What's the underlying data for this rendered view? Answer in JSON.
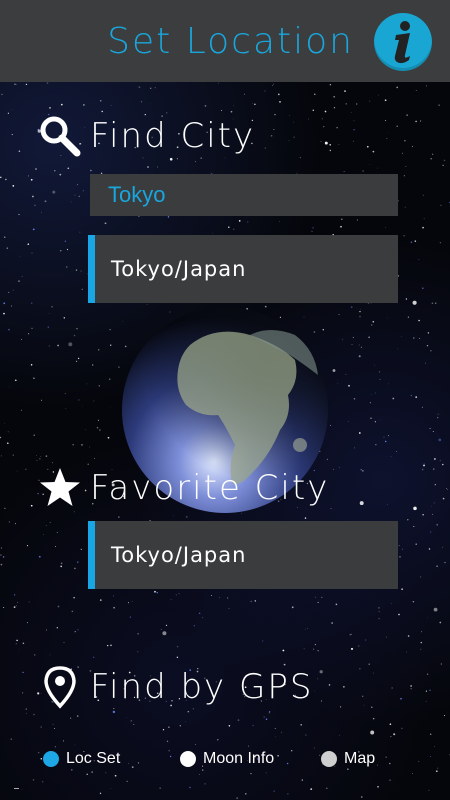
{
  "header": {
    "title": "Set Location",
    "info_icon": "info-icon"
  },
  "find_city": {
    "heading": "Find City",
    "icon": "search-icon",
    "input_value": "Tokyo",
    "result": "Tokyo/Japan"
  },
  "favorite_city": {
    "heading": "Favorite City",
    "icon": "star-icon",
    "city": "Tokyo/Japan"
  },
  "gps": {
    "heading": "Find by GPS",
    "icon": "location-pin-icon"
  },
  "tabs": [
    {
      "label": "Loc Set",
      "color": "#1ea7e6",
      "active": true
    },
    {
      "label": "Moon Info",
      "color": "#ffffff",
      "active": false
    },
    {
      "label": "Map",
      "color": "#cfcfcf",
      "active": false
    }
  ],
  "colors": {
    "accent": "#1aa6dc",
    "titlebar": "#3b3d3e",
    "box": "#3a3c3d"
  }
}
